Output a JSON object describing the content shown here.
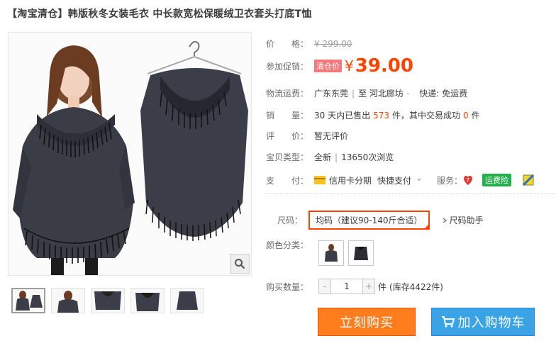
{
  "product": {
    "title": "【淘宝清仓】韩版秋冬女装毛衣 中长款宽松保暖绒卫衣套头打底T恤"
  },
  "price": {
    "label": "价　　格：",
    "original": "¥ 299.00"
  },
  "promo": {
    "label": "参加促销：",
    "tag": "清仓价",
    "currency": "¥",
    "value": "39.00"
  },
  "shipping": {
    "label": "物流运费：",
    "from": "广东东莞",
    "to": "至  河北廊坊",
    "dropdown": "-",
    "fee": "快递: 免运费"
  },
  "sales": {
    "label": "销　　量：",
    "prefix": "30 天内已售出",
    "sold": "573",
    "mid": "件，其中交易成功",
    "success": "0",
    "suffix": "件"
  },
  "rating": {
    "label": "评　　价：",
    "value": "暂无评价"
  },
  "type": {
    "label": "宝贝类型：",
    "value": "全新",
    "views": "13650次浏览"
  },
  "payment": {
    "label": "支　　付：",
    "credit": "信用卡分期",
    "quick": "快捷支付",
    "service_label": "服务：",
    "insurance": "运费险"
  },
  "size": {
    "label": "尺码：",
    "selected": "均码（建议90-140斤合适）",
    "helper": "尺码助手"
  },
  "color": {
    "label": "颜色分类："
  },
  "quantity": {
    "label": "购买数量：",
    "minus": "-",
    "value": "1",
    "plus": "+",
    "unit": "件",
    "stock": "(库存4422件)"
  },
  "actions": {
    "buy": "立刻购买",
    "cart": "加入购物车"
  },
  "colors": {
    "accent": "#ff4400",
    "buy_bg": "#ff7d1d",
    "cart_bg": "#3aa3e6"
  }
}
